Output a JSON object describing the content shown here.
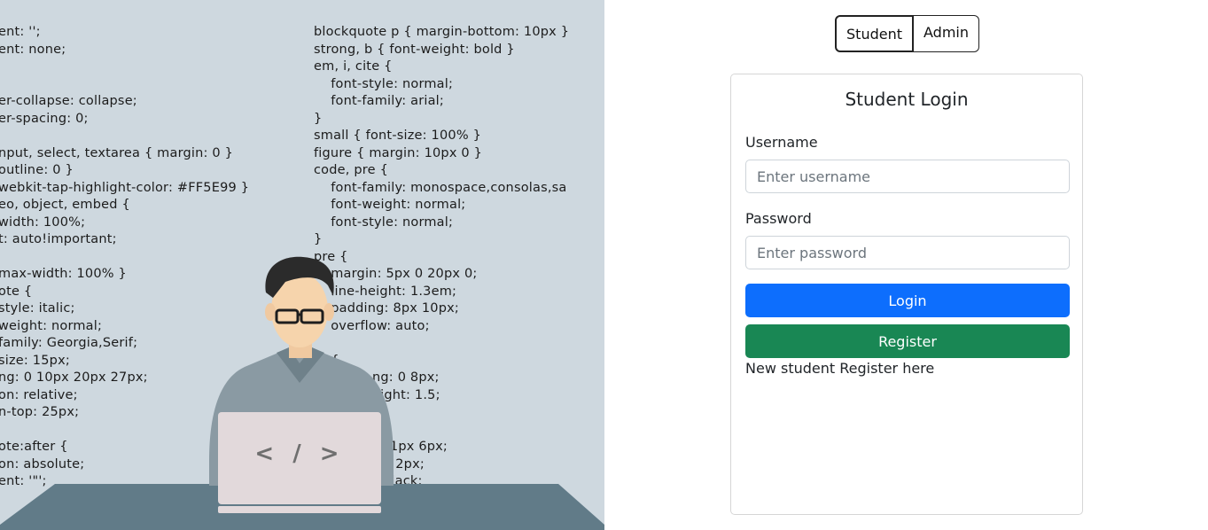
{
  "illustration": {
    "code_lines": [
      "ent: '';",
      "ent: none;",
      "er-collapse: collapse;",
      "er-spacing: 0;",
      "nput, select, textarea { margin: 0 }",
      "outline: 0 }",
      "webkit-tap-highlight-color: #FF5E99 }",
      "eo, object, embed {",
      "width: 100%;",
      "t: auto!important;",
      "max-width: 100% }",
      "ote {",
      "style: italic;",
      "weight: normal;",
      "family: Georgia,Serif;",
      "size: 15px;",
      "ng: 0 10px 20px 27px;",
      "on: relative;",
      "n-top: 25px;",
      "ote:after {",
      "on: absolute;",
      "ent: '\"';",
      "blockquote p { margin-bottom: 10px }",
      "strong, b { font-weight: bold }",
      "em, i, cite {",
      "    font-style: normal;",
      "    font-family: arial;",
      "}",
      "small { font-size: 100% }",
      "figure { margin: 10px 0 }",
      "code, pre {",
      "    font-family: monospace,consolas,sa",
      "    font-weight: normal;",
      "    font-style: normal;",
      "}",
      "pre {",
      "    margin: 5px 0 20px 0;",
      "    line-height: 1.3em;",
      "    padding: 8px 10px;",
      "    overflow: auto;",
      "    {",
      "ng: 0 8px;",
      "eight: 1.5;",
      ": 1px 6px;",
      "0 2px;",
      "black;"
    ],
    "laptop_symbol": "< / >"
  },
  "role_toggle": {
    "student_label": "Student",
    "admin_label": "Admin",
    "selected": "Student"
  },
  "login_card": {
    "title": "Student Login",
    "username_label": "Username",
    "username_placeholder": "Enter username",
    "username_value": "",
    "password_label": "Password",
    "password_placeholder": "Enter password",
    "password_value": "",
    "login_label": "Login",
    "register_label": "Register",
    "register_note": "New student Register here"
  },
  "colors": {
    "illustration_bg": "#ced8df",
    "login_button": "#0d6efd",
    "register_button": "#198754"
  }
}
